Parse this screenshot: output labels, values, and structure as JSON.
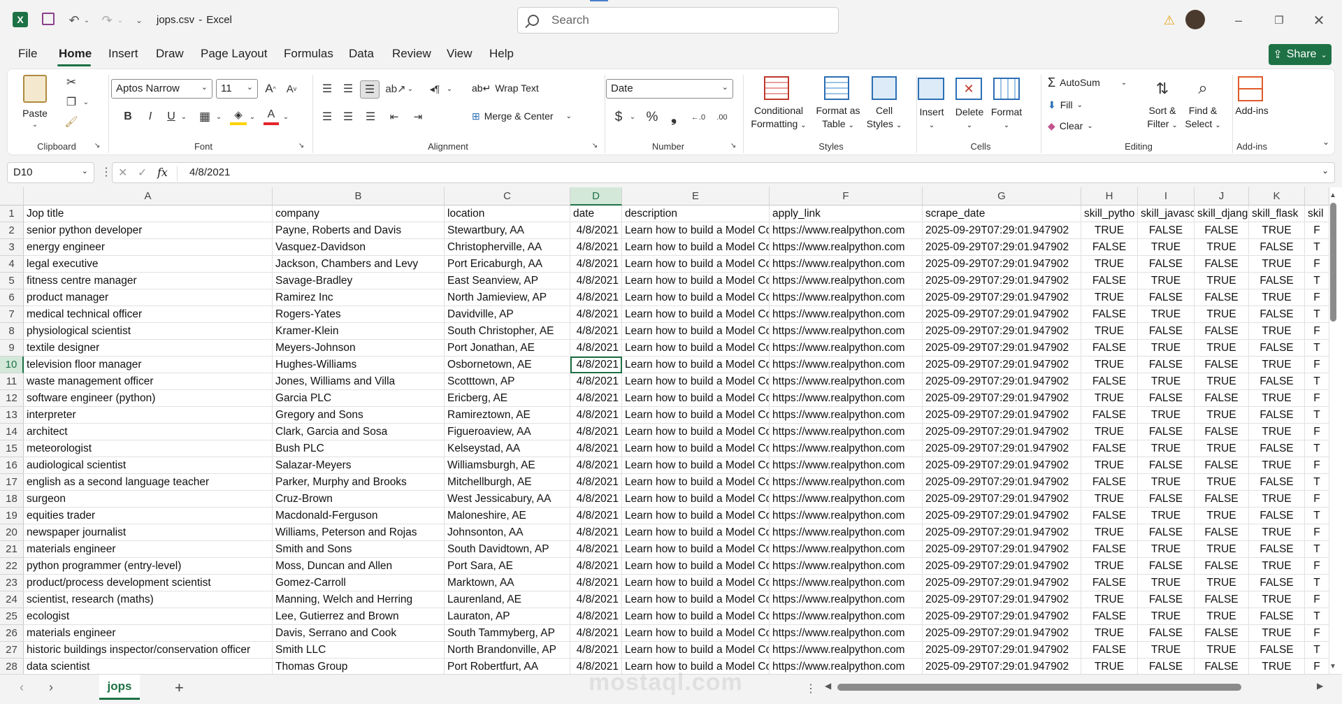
{
  "titlebar": {
    "filename": "jops.csv",
    "sep": "-",
    "app": "Excel",
    "search_placeholder": "Search"
  },
  "menu": [
    "File",
    "Home",
    "Insert",
    "Draw",
    "Page Layout",
    "Formulas",
    "Data",
    "Review",
    "View",
    "Help"
  ],
  "share_label": "Share",
  "ribbon": {
    "paste": "Paste",
    "clipboard": "Clipboard",
    "font_name": "Aptos Narrow",
    "font_size": "11",
    "font_group": "Font",
    "wrap_text": "Wrap Text",
    "merge_center": "Merge & Center",
    "alignment": "Alignment",
    "number_format": "Date",
    "number_group": "Number",
    "conditional": [
      "Conditional",
      "Formatting"
    ],
    "format_table": [
      "Format as",
      "Table"
    ],
    "cell_styles": [
      "Cell",
      "Styles"
    ],
    "styles_group": "Styles",
    "insert": "Insert",
    "delete": "Delete",
    "format": "Format",
    "cells_group": "Cells",
    "autosum": "AutoSum",
    "fill": "Fill",
    "clear": "Clear",
    "sort_filter": [
      "Sort &",
      "Filter"
    ],
    "find_select": [
      "Find &",
      "Select"
    ],
    "editing_group": "Editing",
    "addins": "Add-ins",
    "addins_group": "Add-ins"
  },
  "formula_bar": {
    "name_box": "D10",
    "fx": "fx",
    "value": "4/8/2021"
  },
  "columns": [
    "A",
    "B",
    "C",
    "D",
    "E",
    "F",
    "G",
    "H",
    "I",
    "J",
    "K"
  ],
  "header_row": [
    "Jop title",
    "company",
    "location",
    "date",
    "description",
    "apply_link",
    "scrape_date",
    "skill_pytho",
    "skill_javasc",
    "skill_djang",
    "skill_flask",
    "skil"
  ],
  "rows": [
    [
      "senior python developer",
      "Payne, Roberts and Davis",
      "Stewartbury, AA",
      "TRUE",
      "FALSE",
      "FALSE",
      "TRUE",
      "F"
    ],
    [
      "energy engineer",
      "Vasquez-Davidson",
      "Christopherville, AA",
      "FALSE",
      "TRUE",
      "TRUE",
      "FALSE",
      "T"
    ],
    [
      "legal executive",
      "Jackson, Chambers and Levy",
      "Port Ericaburgh, AA",
      "TRUE",
      "FALSE",
      "FALSE",
      "TRUE",
      "F"
    ],
    [
      "fitness centre manager",
      "Savage-Bradley",
      "East Seanview, AP",
      "FALSE",
      "TRUE",
      "TRUE",
      "FALSE",
      "T"
    ],
    [
      "product manager",
      "Ramirez Inc",
      "North Jamieview, AP",
      "TRUE",
      "FALSE",
      "FALSE",
      "TRUE",
      "F"
    ],
    [
      "medical technical officer",
      "Rogers-Yates",
      "Davidville, AP",
      "FALSE",
      "TRUE",
      "TRUE",
      "FALSE",
      "T"
    ],
    [
      "physiological scientist",
      "Kramer-Klein",
      "South Christopher, AE",
      "TRUE",
      "FALSE",
      "FALSE",
      "TRUE",
      "F"
    ],
    [
      "textile designer",
      "Meyers-Johnson",
      "Port Jonathan, AE",
      "FALSE",
      "TRUE",
      "TRUE",
      "FALSE",
      "T"
    ],
    [
      "television floor manager",
      "Hughes-Williams",
      "Osbornetown, AE",
      "TRUE",
      "FALSE",
      "FALSE",
      "TRUE",
      "F"
    ],
    [
      "waste management officer",
      "Jones, Williams and Villa",
      "Scotttown, AP",
      "FALSE",
      "TRUE",
      "TRUE",
      "FALSE",
      "T"
    ],
    [
      "software engineer (python)",
      "Garcia PLC",
      "Ericberg, AE",
      "TRUE",
      "FALSE",
      "FALSE",
      "TRUE",
      "F"
    ],
    [
      "interpreter",
      "Gregory and Sons",
      "Ramireztown, AE",
      "FALSE",
      "TRUE",
      "TRUE",
      "FALSE",
      "T"
    ],
    [
      "architect",
      "Clark, Garcia and Sosa",
      "Figueroaview, AA",
      "TRUE",
      "FALSE",
      "FALSE",
      "TRUE",
      "F"
    ],
    [
      "meteorologist",
      "Bush PLC",
      "Kelseystad, AA",
      "FALSE",
      "TRUE",
      "TRUE",
      "FALSE",
      "T"
    ],
    [
      "audiological scientist",
      "Salazar-Meyers",
      "Williamsburgh, AE",
      "TRUE",
      "FALSE",
      "FALSE",
      "TRUE",
      "F"
    ],
    [
      "english as a second language teacher",
      "Parker, Murphy and Brooks",
      "Mitchellburgh, AE",
      "FALSE",
      "TRUE",
      "TRUE",
      "FALSE",
      "T"
    ],
    [
      "surgeon",
      "Cruz-Brown",
      "West Jessicabury, AA",
      "TRUE",
      "FALSE",
      "FALSE",
      "TRUE",
      "F"
    ],
    [
      "equities trader",
      "Macdonald-Ferguson",
      "Maloneshire, AE",
      "FALSE",
      "TRUE",
      "TRUE",
      "FALSE",
      "T"
    ],
    [
      "newspaper journalist",
      "Williams, Peterson and Rojas",
      "Johnsonton, AA",
      "TRUE",
      "FALSE",
      "FALSE",
      "TRUE",
      "F"
    ],
    [
      "materials engineer",
      "Smith and Sons",
      "South Davidtown, AP",
      "FALSE",
      "TRUE",
      "TRUE",
      "FALSE",
      "T"
    ],
    [
      "python programmer (entry-level)",
      "Moss, Duncan and Allen",
      "Port Sara, AE",
      "TRUE",
      "FALSE",
      "FALSE",
      "TRUE",
      "F"
    ],
    [
      "product/process development scientist",
      "Gomez-Carroll",
      "Marktown, AA",
      "FALSE",
      "TRUE",
      "TRUE",
      "FALSE",
      "T"
    ],
    [
      "scientist, research (maths)",
      "Manning, Welch and Herring",
      "Laurenland, AE",
      "TRUE",
      "FALSE",
      "FALSE",
      "TRUE",
      "F"
    ],
    [
      "ecologist",
      "Lee, Gutierrez and Brown",
      "Lauraton, AP",
      "FALSE",
      "TRUE",
      "TRUE",
      "FALSE",
      "T"
    ],
    [
      "materials engineer",
      "Davis, Serrano and Cook",
      "South Tammyberg, AP",
      "TRUE",
      "FALSE",
      "FALSE",
      "TRUE",
      "F"
    ],
    [
      "historic buildings inspector/conservation officer",
      "Smith LLC",
      "North Brandonville, AP",
      "FALSE",
      "TRUE",
      "TRUE",
      "FALSE",
      "T"
    ],
    [
      "data scientist",
      "Thomas Group",
      "Port Robertfurt, AA",
      "TRUE",
      "FALSE",
      "FALSE",
      "TRUE",
      "F"
    ]
  ],
  "common": {
    "date": "4/8/2021",
    "description": "Learn how to build a Model Co",
    "apply_link": "https://www.realpython.com",
    "scrape_date": "2025-09-29T07:29:01.947902"
  },
  "sheet_tab": "jops",
  "watermark": "mostaql.com",
  "colors": {
    "excel_green": "#1e7145",
    "selection": "#1e7145"
  }
}
